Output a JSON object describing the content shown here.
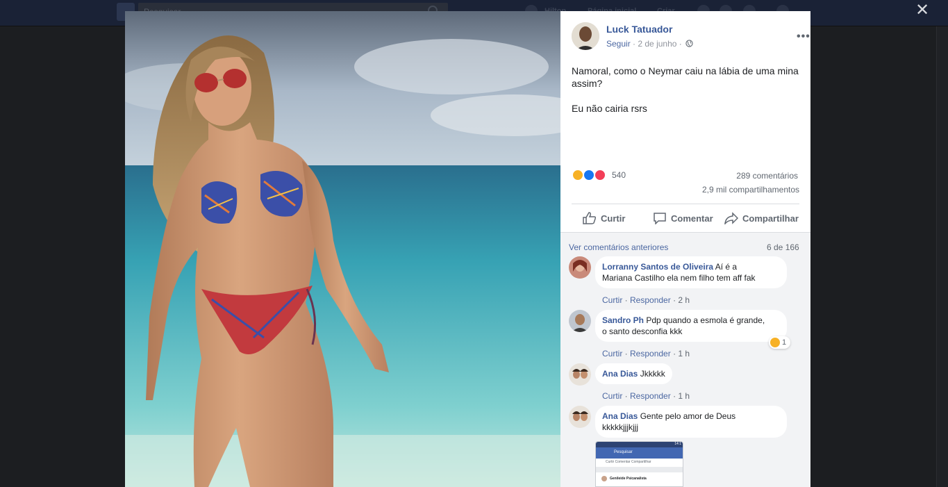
{
  "topbar": {
    "search_placeholder": "Pesquisar",
    "nav_items": [
      "Hilton",
      "Página inicial",
      "Criar"
    ]
  },
  "close_label": "✕",
  "post": {
    "author": "Luck Tatuador",
    "follow": "Seguir",
    "date": "2 de junho",
    "separator": "·",
    "more": "•••",
    "text_line1": "Namoral, como o Neymar caiu na lábia de uma mina assim?",
    "text_line2": "Eu não cairia rsrs",
    "reactions_count": "540",
    "comments_count": "289 comentários",
    "shares_count": "2,9 mil compartilhamentos",
    "reaction_colors": {
      "haha": "#f7b125",
      "like": "#1877f2",
      "love": "#f33e58"
    }
  },
  "actions": {
    "like": "Curtir",
    "comment": "Comentar",
    "share": "Compartilhar"
  },
  "comments_header": {
    "previous": "Ver comentários anteriores",
    "count": "6 de 166"
  },
  "comments": [
    {
      "name": "Lorranny Santos de Oliveira",
      "text_a": "Aí é a",
      "text_b": "Mariana Castilho ela nem filho tem aff fak",
      "like": "Curtir",
      "reply": "Responder",
      "time": "2 h"
    },
    {
      "name": "Sandro Ph",
      "text_a": "Pdp quando a esmola é grande,",
      "text_b": "o santo desconfia kkk",
      "like": "Curtir",
      "reply": "Responder",
      "time": "1 h",
      "reaction_count": "1"
    },
    {
      "name": "Ana Dias",
      "text_a": "Jkkkkk",
      "like": "Curtir",
      "reply": "Responder",
      "time": "1 h"
    },
    {
      "name": "Ana Dias",
      "text_a": "Gente pelo amor de Deus",
      "text_b": "kkkkkjjjkjjj"
    }
  ],
  "attachment": {
    "status": "14:1",
    "search": "Pesquisar",
    "tabs": "Curtir     Comentar     Compartilhar",
    "row": "Genileide Psicanalista"
  }
}
